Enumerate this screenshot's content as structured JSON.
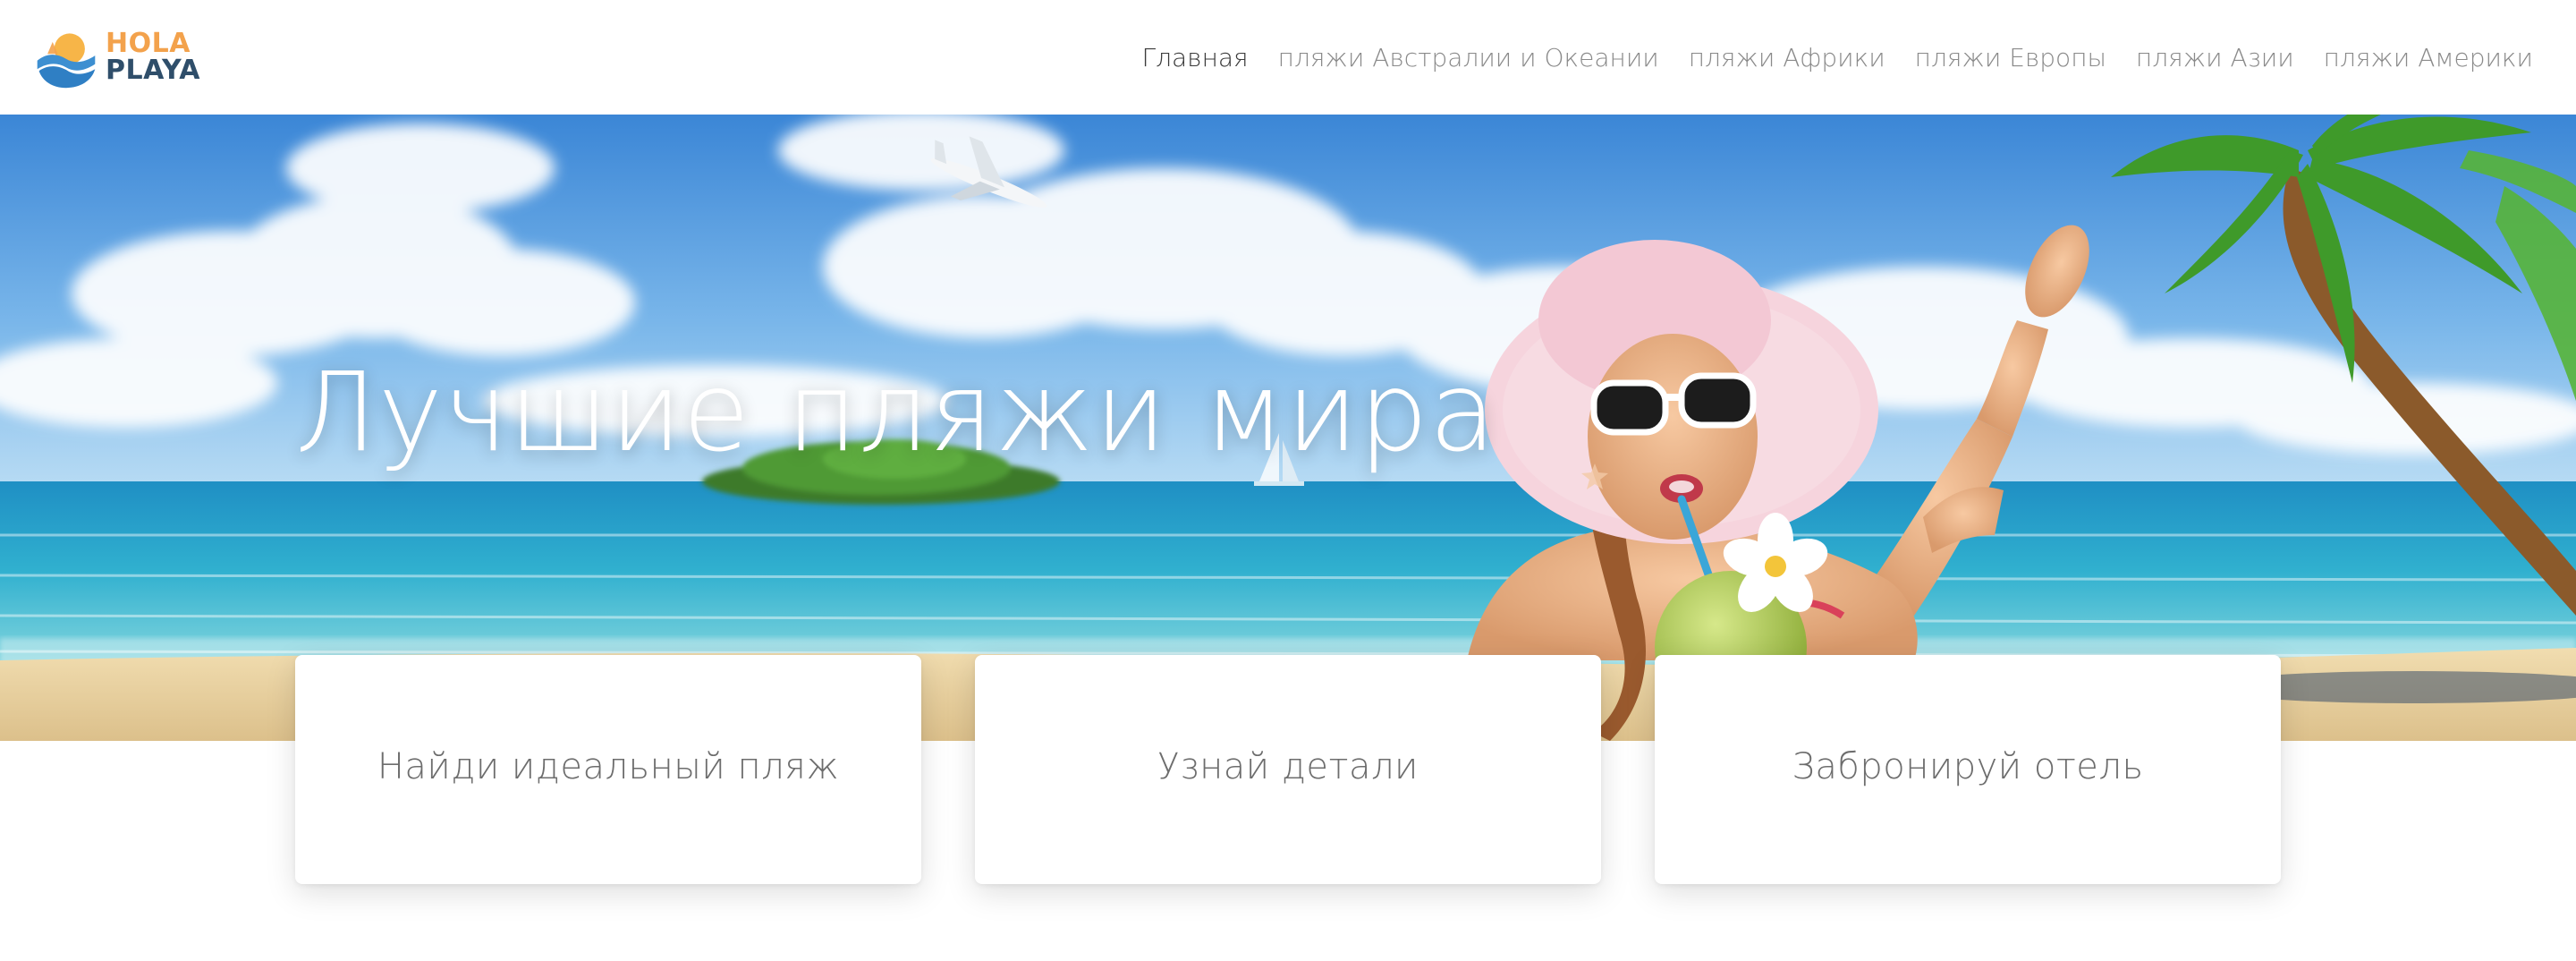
{
  "header": {
    "logo": {
      "line1": "HOLA",
      "line2": "PLAYA"
    },
    "nav": [
      {
        "label": "Главная",
        "active": true
      },
      {
        "label": "пляжи Австралии и Океании",
        "active": false
      },
      {
        "label": "пляжи Африки",
        "active": false
      },
      {
        "label": "пляжи Европы",
        "active": false
      },
      {
        "label": "пляжи Азии",
        "active": false
      },
      {
        "label": "пляжи Америки",
        "active": false
      }
    ]
  },
  "hero": {
    "title": "Лучшие пляжи мира"
  },
  "cards": [
    {
      "label": "Найди идеальный пляж"
    },
    {
      "label": "Узнай детали"
    },
    {
      "label": "Забронируй отель"
    }
  ],
  "colors": {
    "logo_orange": "#f3a24c",
    "logo_navy": "#2f4e6a",
    "logo_wave": "#3d8fd1",
    "nav_active": "#3a3a3a",
    "nav_inactive": "#8a8a8a",
    "sky_top": "#3f8fdc",
    "sea": "#2aa7c9",
    "sand": "#ead3a2"
  }
}
